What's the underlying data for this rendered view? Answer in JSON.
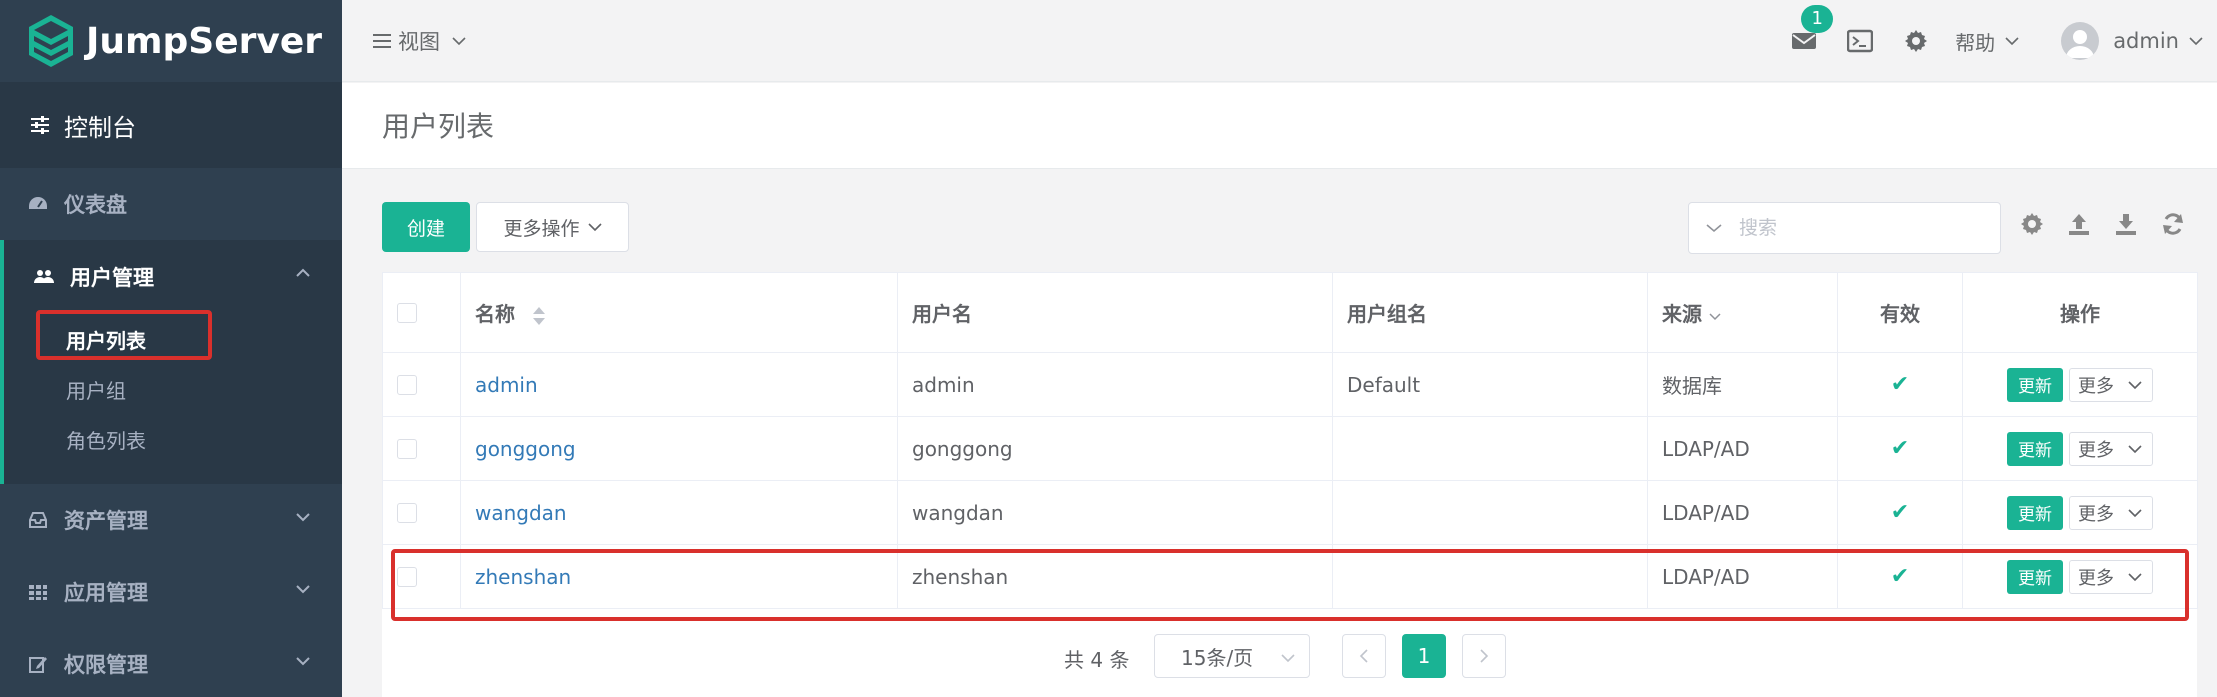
{
  "app": {
    "name": "JumpServer"
  },
  "sidebar": {
    "console_label": "控制台",
    "items": [
      {
        "label": "仪表盘",
        "icon": "dashboard-icon"
      },
      {
        "label": "用户管理",
        "icon": "users-icon",
        "expanded": true,
        "children": [
          {
            "label": "用户列表",
            "active": true
          },
          {
            "label": "用户组"
          },
          {
            "label": "角色列表"
          }
        ]
      },
      {
        "label": "资产管理",
        "icon": "inbox-icon"
      },
      {
        "label": "应用管理",
        "icon": "grid-icon"
      },
      {
        "label": "权限管理",
        "icon": "edit-icon"
      }
    ]
  },
  "topbar": {
    "view_label": "视图",
    "notification_count": "1",
    "help_label": "帮助",
    "username": "admin"
  },
  "page": {
    "title": "用户列表"
  },
  "toolbar": {
    "create_label": "创建",
    "more_actions_label": "更多操作",
    "search_placeholder": "搜索"
  },
  "table": {
    "headers": {
      "name": "名称",
      "username": "用户名",
      "groups": "用户组名",
      "source": "来源",
      "valid": "有效",
      "actions": "操作"
    },
    "rows": [
      {
        "name": "admin",
        "username": "admin",
        "groups": "Default",
        "source": "数据库",
        "valid": "✔"
      },
      {
        "name": "gonggong",
        "username": "gonggong",
        "groups": "",
        "source": "LDAP/AD",
        "valid": "✔"
      },
      {
        "name": "wangdan",
        "username": "wangdan",
        "groups": "",
        "source": "LDAP/AD",
        "valid": "✔"
      },
      {
        "name": "zhenshan",
        "username": "zhenshan",
        "groups": "",
        "source": "LDAP/AD",
        "valid": "✔"
      }
    ],
    "update_label": "更新",
    "more_label": "更多"
  },
  "pagination": {
    "total_text": "共 4 条",
    "page_size": "15条/页",
    "current_page": "1"
  },
  "colors": {
    "accent": "#1ab394",
    "sidebar": "#2f4050",
    "highlight": "#d9302c",
    "link": "#337ab7"
  }
}
